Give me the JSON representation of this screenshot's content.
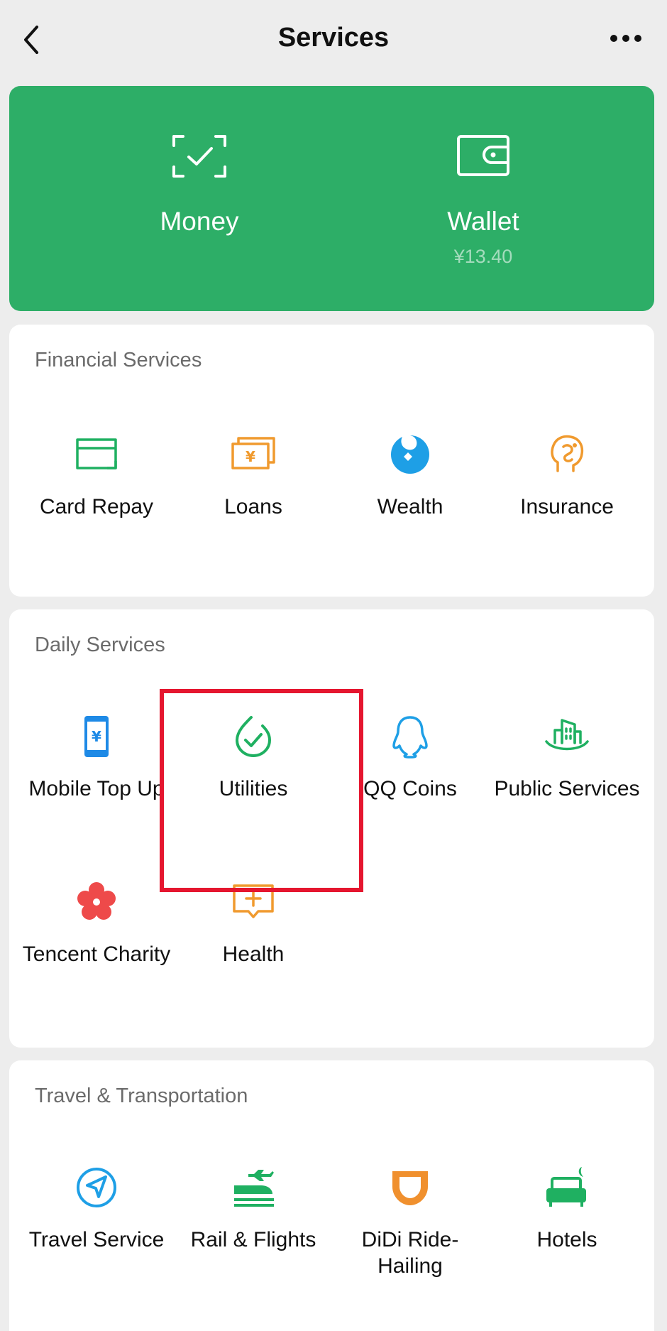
{
  "header": {
    "title": "Services",
    "back_icon": "chevron-left-icon",
    "more_icon": "more-dots-icon"
  },
  "banner": {
    "color": "#2dae67",
    "money": {
      "label": "Money",
      "icon": "scan-check-icon"
    },
    "wallet": {
      "label": "Wallet",
      "amount": "¥13.40",
      "icon": "wallet-icon"
    }
  },
  "financial": {
    "title": "Financial Services",
    "items": [
      {
        "label": "Card Repay",
        "icon": "card-repay-icon"
      },
      {
        "label": "Loans",
        "icon": "loans-icon"
      },
      {
        "label": "Wealth",
        "icon": "wealth-icon"
      },
      {
        "label": "Insurance",
        "icon": "insurance-icon"
      }
    ]
  },
  "daily": {
    "title": "Daily Services",
    "items": [
      {
        "label": "Mobile Top Up",
        "icon": "mobile-topup-icon"
      },
      {
        "label": "Utilities",
        "icon": "utilities-icon"
      },
      {
        "label": "QQ Coins",
        "icon": "qq-coins-icon"
      },
      {
        "label": "Public Services",
        "icon": "public-services-icon"
      },
      {
        "label": "Tencent Charity",
        "icon": "charity-icon"
      },
      {
        "label": "Health",
        "icon": "health-icon"
      }
    ]
  },
  "travel": {
    "title": "Travel & Transportation",
    "items": [
      {
        "label": "Travel Service",
        "icon": "travel-service-icon"
      },
      {
        "label": "Rail & Flights",
        "icon": "rail-flights-icon"
      },
      {
        "label": "DiDi Ride-Hailing",
        "icon": "didi-icon"
      },
      {
        "label": "Hotels",
        "icon": "hotels-icon"
      }
    ]
  }
}
